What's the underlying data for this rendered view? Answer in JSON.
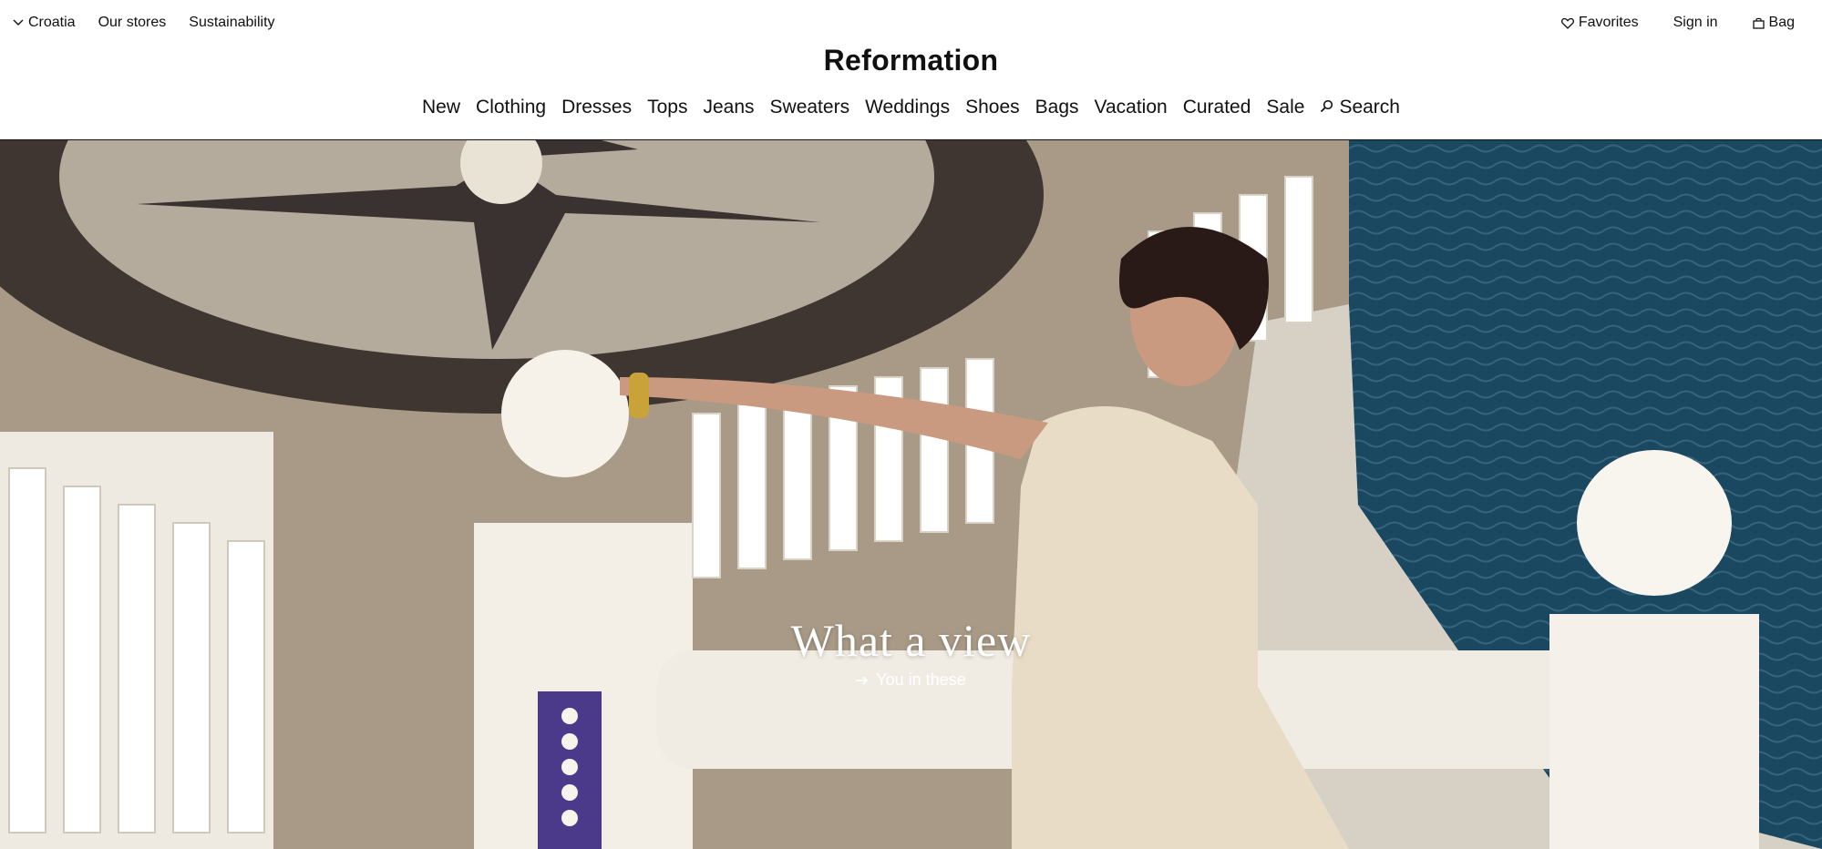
{
  "utility": {
    "country": "Croatia",
    "stores": "Our stores",
    "sustainability": "Sustainability",
    "favorites": "Favorites",
    "sign_in": "Sign in",
    "bag": "Bag"
  },
  "brand": "Reformation",
  "nav": {
    "items": [
      "New",
      "Clothing",
      "Dresses",
      "Tops",
      "Jeans",
      "Sweaters",
      "Weddings",
      "Shoes",
      "Bags",
      "Vacation",
      "Curated",
      "Sale"
    ],
    "search": "Search"
  },
  "hero": {
    "title": "What a view",
    "cta": "You in these"
  }
}
